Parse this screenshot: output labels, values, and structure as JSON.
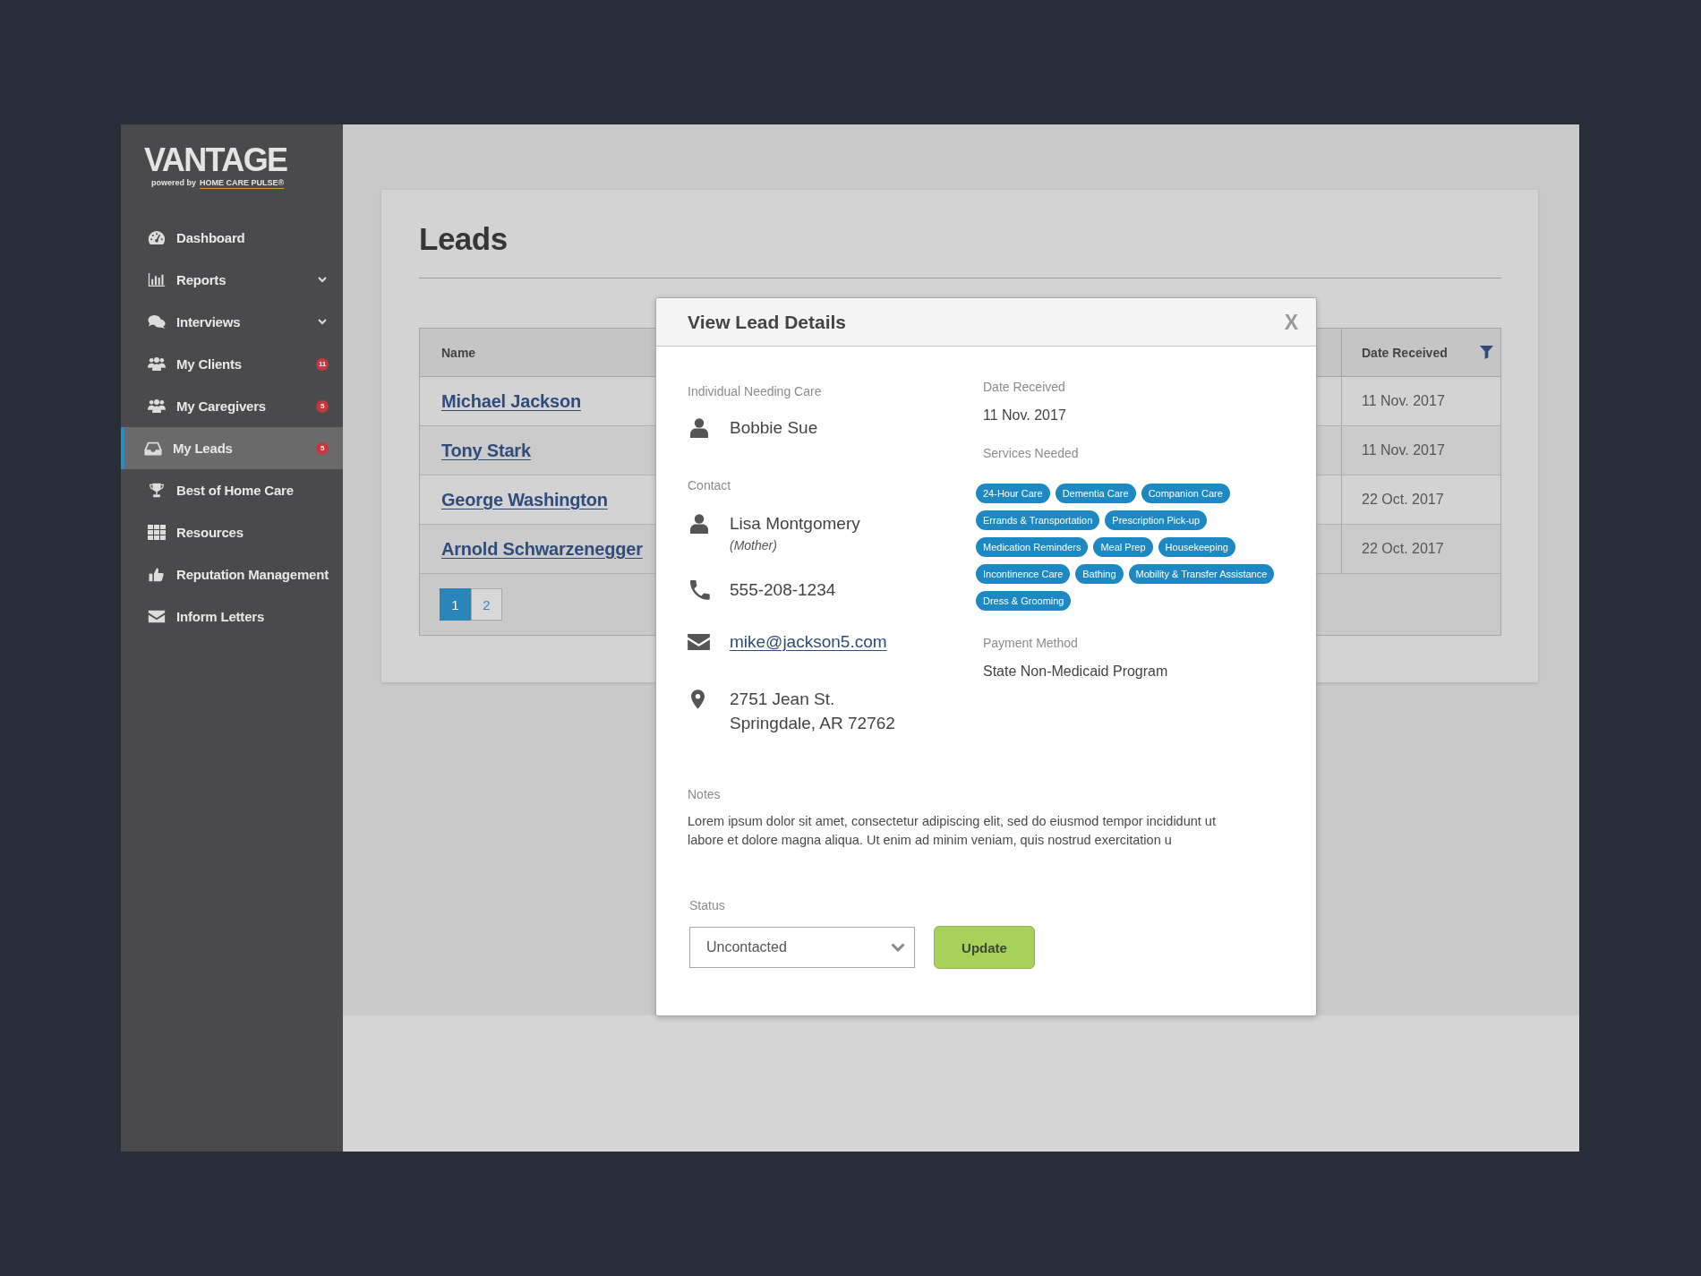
{
  "sidebar": {
    "logo": {
      "wordmark": "VANTAGE",
      "tagline": "powered by",
      "brand": "HOME CARE PULSE®"
    },
    "items": [
      {
        "label": "Dashboard",
        "kind": "link",
        "selected": false
      },
      {
        "label": "Reports",
        "kind": "group",
        "selected": false
      },
      {
        "label": "Interviews",
        "kind": "group",
        "selected": false
      },
      {
        "label": "My Clients",
        "kind": "link",
        "badge": "11",
        "selected": false
      },
      {
        "label": "My Caregivers",
        "kind": "link",
        "badge": "5",
        "selected": false
      },
      {
        "label": "My Leads",
        "kind": "link",
        "badge": "5",
        "selected": true
      },
      {
        "label": "Best of Home Care",
        "kind": "link",
        "selected": false
      },
      {
        "label": "Resources",
        "kind": "link",
        "selected": false
      },
      {
        "label": "Reputation Management",
        "kind": "link",
        "selected": false
      },
      {
        "label": "Inform Letters",
        "kind": "link",
        "selected": false
      }
    ]
  },
  "page": {
    "title": "Leads",
    "table": {
      "columns": [
        {
          "label": "Name",
          "filter": false
        },
        {
          "label": "Date Received",
          "filter": true
        }
      ],
      "rows": [
        {
          "name": "Michael Jackson",
          "date_received": "11 Nov. 2017"
        },
        {
          "name": "Tony Stark",
          "date_received": "11 Nov. 2017"
        },
        {
          "name": "George Washington",
          "date_received": "22 Oct. 2017"
        },
        {
          "name": "Arnold Schwarzenegger",
          "date_received": "22 Oct. 2017"
        }
      ],
      "pagination": [
        {
          "label": "1",
          "selected": true
        },
        {
          "label": "2",
          "selected": false
        }
      ]
    }
  },
  "modal": {
    "title": "View Lead Details",
    "close": "X",
    "individual": {
      "label": "Individual Needing Care",
      "name": "Bobbie Sue"
    },
    "contact": {
      "label": "Contact",
      "name": "Lisa Montgomery",
      "relation": "(Mother)",
      "phone": "555-208-1234",
      "email": "mike@jackson5.com",
      "address": [
        "2751 Jean St.",
        "Springdale, AR 72762"
      ]
    },
    "date_received": {
      "label": "Date Received",
      "value": "11 Nov. 2017"
    },
    "services": {
      "label": "Services Needed",
      "tags": [
        "24-Hour Care",
        "Dementia Care",
        "Companion Care",
        "Errands & Transportation",
        "Prescription Pick-up",
        "Medication Reminders",
        "Meal Prep",
        "Housekeeping",
        "Incontinence Care",
        "Bathing",
        "Mobility & Transfer Assistance",
        "Dress & Grooming"
      ]
    },
    "payment": {
      "label": "Payment Method",
      "value": "State Non-Medicaid Program"
    },
    "notes": {
      "label": "Notes",
      "text": "Lorem ipsum dolor sit amet, consectetur adipiscing elit, sed do eiusmod tempor incididunt ut labore et dolore magna aliqua. Ut enim ad minim veniam, quis nostrud exercitation u"
    },
    "status": {
      "label": "Status",
      "value": "Uncontacted"
    },
    "button": "Update"
  }
}
